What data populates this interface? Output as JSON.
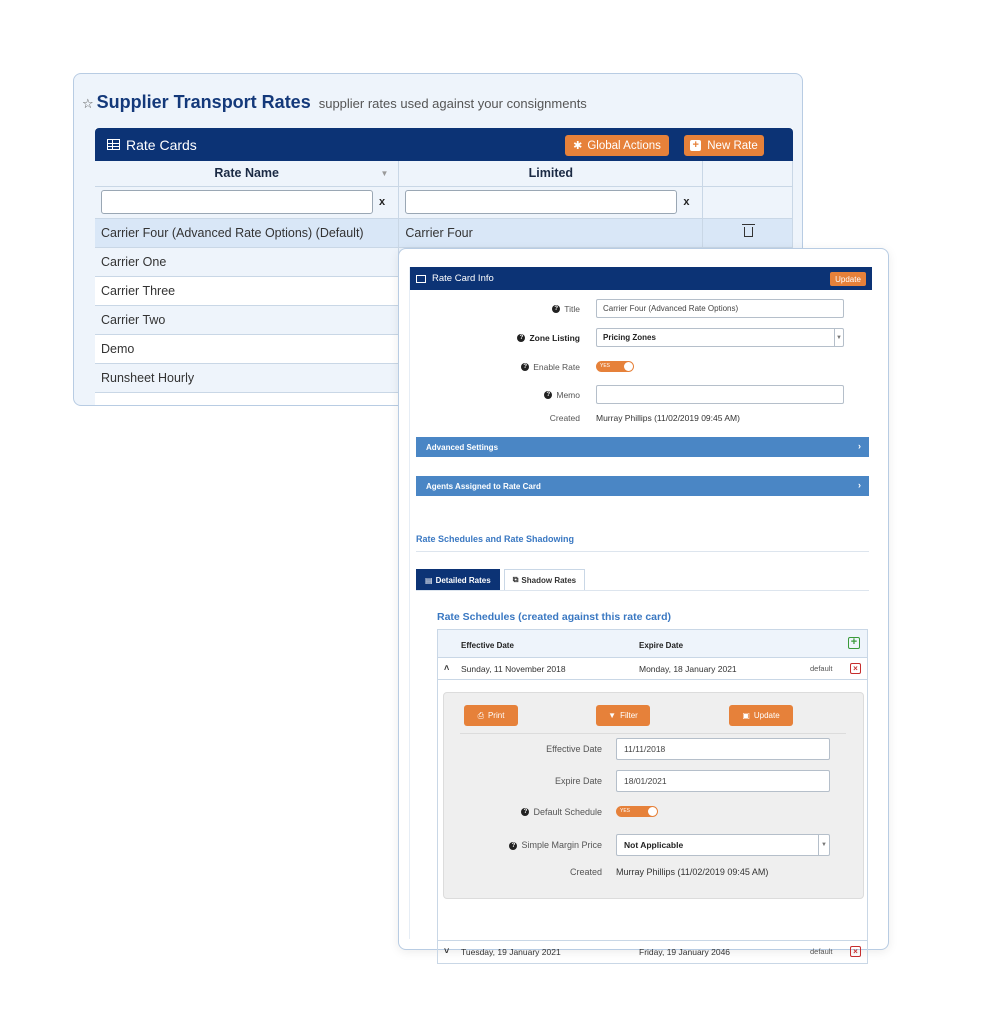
{
  "page": {
    "star_icon": "☆",
    "title": "Supplier Transport Rates",
    "subtitle": "supplier rates used against your consignments"
  },
  "rate_cards": {
    "title": "Rate Cards",
    "global_actions": "Global Actions",
    "new_rate": "New Rate",
    "columns": [
      "Rate Name",
      "Limited"
    ],
    "filter_clear": "x",
    "rows": [
      {
        "name": "Carrier Four (Advanced Rate Options) (Default)",
        "limited": "Carrier Four"
      },
      {
        "name": "Carrier One",
        "limited": ""
      },
      {
        "name": "Carrier Three",
        "limited": ""
      },
      {
        "name": "Carrier Two",
        "limited": ""
      },
      {
        "name": "Demo",
        "limited": ""
      },
      {
        "name": "Runsheet Hourly",
        "limited": ""
      }
    ]
  },
  "info": {
    "header": "Rate Card Info",
    "update": "Update",
    "title_label": "Title",
    "title_value": "Carrier Four (Advanced Rate Options)",
    "zone_label": "Zone Listing",
    "zone_value": "Pricing Zones",
    "enable_label": "Enable Rate",
    "toggle_yes": "YES",
    "memo_label": "Memo",
    "created_label": "Created",
    "created_value": "Murray Phillips (11/02/2019 09:45 AM)",
    "advanced": "Advanced Settings",
    "agents": "Agents Assigned to Rate Card",
    "section_title": "Rate Schedules and Rate Shadowing",
    "tab_detailed": "Detailed Rates",
    "tab_shadow": "Shadow Rates"
  },
  "schedules": {
    "title": "Rate Schedules (created against this rate card)",
    "col_effective": "Effective Date",
    "col_expire": "Expire Date",
    "rows": [
      {
        "effective": "Sunday, 11 November 2018",
        "expire": "Monday, 18 January 2021",
        "tag": "default"
      },
      {
        "effective": "Tuesday, 19 January 2021",
        "expire": "Friday, 19 January 2046",
        "tag": "default"
      }
    ],
    "detail": {
      "print": "Print",
      "filter": "Filter",
      "update": "Update",
      "effective_label": "Effective Date",
      "effective_value": "11/11/2018",
      "expire_label": "Expire Date",
      "expire_value": "18/01/2021",
      "default_label": "Default Schedule",
      "toggle_yes": "YES",
      "margin_label": "Simple Margin Price",
      "margin_value": "Not Applicable",
      "created_label": "Created",
      "created_value": "Murray Phillips (11/02/2019 09:45 AM)"
    }
  },
  "colors": {
    "navy": "#0c3375",
    "orange": "#e6813a",
    "accent_blue": "#3a78c2",
    "accordion_blue": "#4a86c5"
  }
}
